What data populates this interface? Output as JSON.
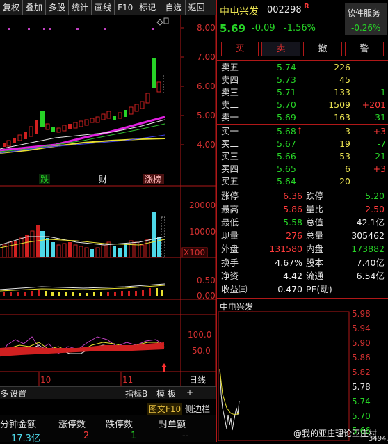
{
  "toolbar": {
    "items": [
      "复权",
      "叠加",
      "多股",
      "统计",
      "画线",
      "F10",
      "标记",
      "-自选",
      "返回"
    ]
  },
  "price_axis": [
    "8.00",
    "7.00",
    "6.00",
    "5.00",
    "4.00"
  ],
  "volume_axis": [
    "20000",
    "10000"
  ],
  "volume_unit": "X100",
  "macd_axis": [
    "0.50",
    "0.00"
  ],
  "kdj_axis": [
    "100.0",
    "50.0"
  ],
  "kline_labels": {
    "die": "跌",
    "cai": "财",
    "zhangbang": "涨榜"
  },
  "date_labels": {
    "oct": "10",
    "nov": "11"
  },
  "bottom_bar": {
    "left_partial": "多",
    "settings": "设置",
    "indicator": "指标B",
    "template": "模 板",
    "plus": "+",
    "minus": "-",
    "period": "日线"
  },
  "bottom_bar2": {
    "f10": "图文F10",
    "sidebar": "侧边栏"
  },
  "stat_table": {
    "headers": [
      "分钟金额",
      "涨停数",
      "跌停数",
      "封单额"
    ],
    "values": [
      "17.3亿",
      "2",
      "1",
      "--"
    ]
  },
  "stock": {
    "name": "中电兴发",
    "code": "002298",
    "tag": "R",
    "service": "软件服务",
    "price": "5.69",
    "change": "-0.09",
    "change_pct": "-1.56%",
    "service_pct": "-0.26%"
  },
  "buttons": {
    "buy": "买",
    "sell": "卖",
    "cancel": "撤",
    "alert": "警"
  },
  "asks": [
    {
      "label": "卖五",
      "price": "5.74",
      "vol": "226",
      "chg": ""
    },
    {
      "label": "卖四",
      "price": "5.73",
      "vol": "45",
      "chg": ""
    },
    {
      "label": "卖三",
      "price": "5.71",
      "vol": "133",
      "chg": "-1"
    },
    {
      "label": "卖二",
      "price": "5.70",
      "vol": "1509",
      "chg": "+201"
    },
    {
      "label": "卖一",
      "price": "5.69",
      "vol": "163",
      "chg": "-31"
    }
  ],
  "bids": [
    {
      "label": "买一",
      "price": "5.68",
      "vol": "3",
      "chg": "+3"
    },
    {
      "label": "买二",
      "price": "5.67",
      "vol": "19",
      "chg": "-7"
    },
    {
      "label": "买三",
      "price": "5.66",
      "vol": "53",
      "chg": "-21"
    },
    {
      "label": "买四",
      "price": "5.65",
      "vol": "6",
      "chg": "+3"
    },
    {
      "label": "买五",
      "price": "5.64",
      "vol": "20",
      "chg": ""
    }
  ],
  "stats": [
    {
      "l1": "涨停",
      "v1": "6.36",
      "l2": "跌停",
      "v2": "5.20"
    },
    {
      "l1": "最高",
      "v1": "5.86",
      "l2": "量比",
      "v2": "2.50"
    },
    {
      "l1": "最低",
      "v1": "5.58",
      "l2": "总值",
      "v2": "42.1亿"
    },
    {
      "l1": "现量",
      "v1": "276",
      "l2": "总量",
      "v2": "305462"
    },
    {
      "l1": "外盘",
      "v1": "131580",
      "l2": "内盘",
      "v2": "173882"
    }
  ],
  "stats2": [
    {
      "l1": "换手",
      "v1": "4.67%",
      "l2": "股本",
      "v2": "7.40亿"
    },
    {
      "l1": "净资",
      "v1": "4.42",
      "l2": "流通",
      "v2": "6.54亿"
    },
    {
      "l1": "收益㈢",
      "v1": "-0.470",
      "l2": "PE(动)",
      "v2": "-"
    }
  ],
  "mini_chart": {
    "title": "中电兴发",
    "axis": [
      "5.98",
      "5.94",
      "5.90",
      "5.86",
      "5.82",
      "5.78",
      "5.74",
      "5.70",
      "5.66"
    ],
    "bottom_value": "34947"
  },
  "watermark": "@我的亚庄理论亚庄村"
}
